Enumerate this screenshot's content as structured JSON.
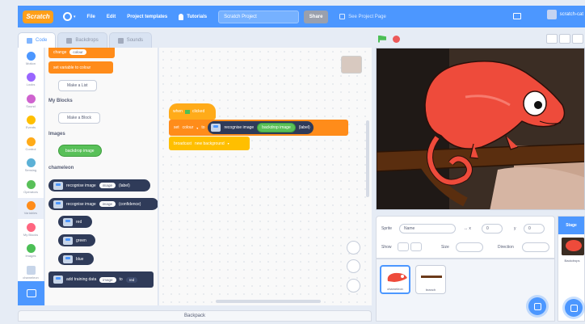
{
  "menubar": {
    "logo": "Scratch",
    "file": "File",
    "edit": "Edit",
    "templates": "Project templates",
    "tutorials": "Tutorials",
    "project_title": "Scratch Project",
    "share": "Share",
    "see_page": "See Project Page",
    "username": "scratch-cat"
  },
  "tabs": {
    "code": "Code",
    "backdrops": "Backdrops",
    "sounds": "Sounds"
  },
  "categories": [
    {
      "label": "Motion",
      "color": "#4c97ff"
    },
    {
      "label": "Looks",
      "color": "#9966ff"
    },
    {
      "label": "Sound",
      "color": "#cf63cf"
    },
    {
      "label": "Events",
      "color": "#ffbf00"
    },
    {
      "label": "Control",
      "color": "#ffab19"
    },
    {
      "label": "Sensing",
      "color": "#5cb1d6"
    },
    {
      "label": "Operators",
      "color": "#59c059"
    },
    {
      "label": "Variables",
      "color": "#ff8c1a"
    },
    {
      "label": "My Blocks",
      "color": "#ff6680"
    },
    {
      "label": "Images",
      "color": "#4cbf56"
    },
    {
      "label": "chameleon",
      "color": "#c7d5e9"
    }
  ],
  "palette": {
    "set_variable": "set variable to colour",
    "set_variable_value": "colour",
    "make_list": "Make a List",
    "my_blocks_header": "My Blocks",
    "make_block": "Make a Block",
    "images_header": "Images",
    "backdrop_image": "backdrop image",
    "chameleon_header": "chameleon",
    "recognise_image": "recognise image",
    "image_label": "image",
    "label_suffix": "(label)",
    "recognise_image_2": "recognise image",
    "confidence_suffix": "(confidence)",
    "red": "red",
    "green": "green",
    "blue": "blue",
    "add_training": "add training data",
    "to": "to",
    "red_option": "red"
  },
  "code": {
    "hat": "when clicked",
    "set_label": "set",
    "set_variable": "colour",
    "to": "to",
    "recognise": "recognise image",
    "backdrop_image": "backdrop image",
    "label_suffix": "(label)",
    "broadcast": "broadcast",
    "broadcast_message": "new background"
  },
  "backpack": "Backpack",
  "sprite_info": {
    "sprite_label": "Sprite",
    "sprite_name": "Name",
    "x_value": "0",
    "y_label": "y",
    "y_value": "0",
    "show_label": "Show",
    "size_label": "Size",
    "direction_label": "Direction"
  },
  "sprites": [
    {
      "name": "chameleon"
    },
    {
      "name": "branch"
    }
  ],
  "stage_panel": {
    "title": "Stage",
    "backdrops_label": "Backdrops"
  }
}
